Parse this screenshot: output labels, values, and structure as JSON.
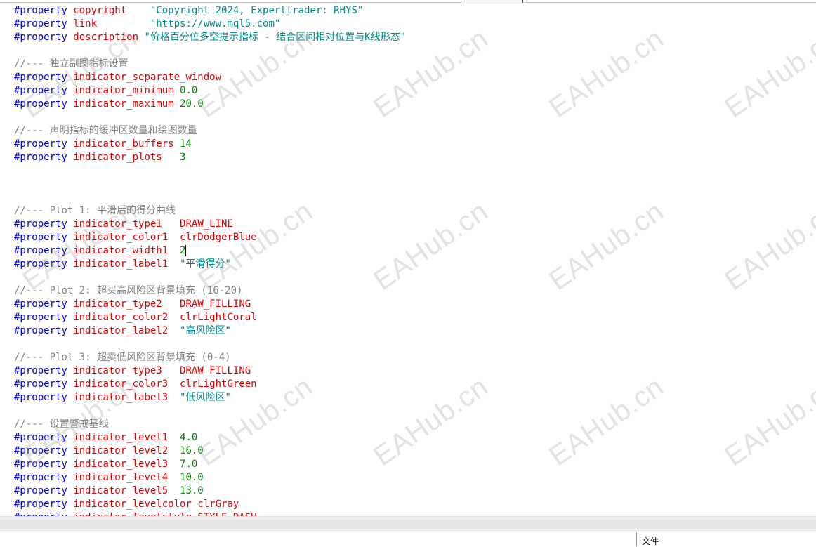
{
  "watermark": "EAHub.cn",
  "bottom_tab": "文件",
  "code_lines": [
    [
      [
        "kw",
        "#property"
      ],
      [
        "t",
        " "
      ],
      [
        "prop",
        "copyright"
      ],
      [
        "t",
        "    "
      ],
      [
        "str",
        "\"Copyright 2024, Experttrader: RHYS\""
      ]
    ],
    [
      [
        "kw",
        "#property"
      ],
      [
        "t",
        " "
      ],
      [
        "prop",
        "link"
      ],
      [
        "t",
        "         "
      ],
      [
        "str",
        "\"https://www.mql5.com\""
      ]
    ],
    [
      [
        "kw",
        "#property"
      ],
      [
        "t",
        " "
      ],
      [
        "prop",
        "description"
      ],
      [
        "t",
        " "
      ],
      [
        "str",
        "\"价格百分位多空提示指标 - 结合区间相对位置与K线形态\""
      ]
    ],
    [],
    [
      [
        "cm",
        "//--- 独立副图指标设置"
      ]
    ],
    [
      [
        "kw",
        "#property"
      ],
      [
        "t",
        " "
      ],
      [
        "prop",
        "indicator_separate_window"
      ]
    ],
    [
      [
        "kw",
        "#property"
      ],
      [
        "t",
        " "
      ],
      [
        "prop",
        "indicator_minimum"
      ],
      [
        "t",
        " "
      ],
      [
        "num",
        "0.0"
      ]
    ],
    [
      [
        "kw",
        "#property"
      ],
      [
        "t",
        " "
      ],
      [
        "prop",
        "indicator_maximum"
      ],
      [
        "t",
        " "
      ],
      [
        "num",
        "20.0"
      ]
    ],
    [],
    [
      [
        "cm",
        "//--- 声明指标的缓冲区数量和绘图数量"
      ]
    ],
    [
      [
        "kw",
        "#property"
      ],
      [
        "t",
        " "
      ],
      [
        "prop",
        "indicator_buffers"
      ],
      [
        "t",
        " "
      ],
      [
        "num",
        "14"
      ]
    ],
    [
      [
        "kw",
        "#property"
      ],
      [
        "t",
        " "
      ],
      [
        "prop",
        "indicator_plots"
      ],
      [
        "t",
        "   "
      ],
      [
        "num",
        "3"
      ]
    ],
    [],
    [],
    [],
    [
      [
        "cm",
        "//--- Plot 1: 平滑后的得分曲线"
      ]
    ],
    [
      [
        "kw",
        "#property"
      ],
      [
        "t",
        " "
      ],
      [
        "prop",
        "indicator_type1"
      ],
      [
        "t",
        "   "
      ],
      [
        "prop",
        "DRAW_LINE"
      ]
    ],
    [
      [
        "kw",
        "#property"
      ],
      [
        "t",
        " "
      ],
      [
        "prop",
        "indicator_color1"
      ],
      [
        "t",
        "  "
      ],
      [
        "prop",
        "clrDodgerBlue"
      ]
    ],
    [
      [
        "kw",
        "#property"
      ],
      [
        "t",
        " "
      ],
      [
        "prop",
        "indicator_width1"
      ],
      [
        "t",
        "  "
      ],
      [
        "num",
        "2"
      ],
      [
        "caret",
        ""
      ]
    ],
    [
      [
        "kw",
        "#property"
      ],
      [
        "t",
        " "
      ],
      [
        "prop",
        "indicator_label1"
      ],
      [
        "t",
        "  "
      ],
      [
        "str",
        "\"平滑得分\""
      ]
    ],
    [],
    [
      [
        "cm",
        "//--- Plot 2: 超买高风险区背景填充 (16-20)"
      ]
    ],
    [
      [
        "kw",
        "#property"
      ],
      [
        "t",
        " "
      ],
      [
        "prop",
        "indicator_type2"
      ],
      [
        "t",
        "   "
      ],
      [
        "prop",
        "DRAW_FILLING"
      ]
    ],
    [
      [
        "kw",
        "#property"
      ],
      [
        "t",
        " "
      ],
      [
        "prop",
        "indicator_color2"
      ],
      [
        "t",
        "  "
      ],
      [
        "prop",
        "clrLightCoral"
      ]
    ],
    [
      [
        "kw",
        "#property"
      ],
      [
        "t",
        " "
      ],
      [
        "prop",
        "indicator_label2"
      ],
      [
        "t",
        "  "
      ],
      [
        "str",
        "\"高风险区\""
      ]
    ],
    [],
    [
      [
        "cm",
        "//--- Plot 3: 超卖低风险区背景填充 (0-4)"
      ]
    ],
    [
      [
        "kw",
        "#property"
      ],
      [
        "t",
        " "
      ],
      [
        "prop",
        "indicator_type3"
      ],
      [
        "t",
        "   "
      ],
      [
        "prop",
        "DRAW_FILLING"
      ]
    ],
    [
      [
        "kw",
        "#property"
      ],
      [
        "t",
        " "
      ],
      [
        "prop",
        "indicator_color3"
      ],
      [
        "t",
        "  "
      ],
      [
        "prop",
        "clrLightGreen"
      ]
    ],
    [
      [
        "kw",
        "#property"
      ],
      [
        "t",
        " "
      ],
      [
        "prop",
        "indicator_label3"
      ],
      [
        "t",
        "  "
      ],
      [
        "str",
        "\"低风险区\""
      ]
    ],
    [],
    [
      [
        "cm",
        "//--- 设置警戒基线"
      ]
    ],
    [
      [
        "kw",
        "#property"
      ],
      [
        "t",
        " "
      ],
      [
        "prop",
        "indicator_level1"
      ],
      [
        "t",
        "  "
      ],
      [
        "num",
        "4.0"
      ]
    ],
    [
      [
        "kw",
        "#property"
      ],
      [
        "t",
        " "
      ],
      [
        "prop",
        "indicator_level2"
      ],
      [
        "t",
        "  "
      ],
      [
        "num",
        "16.0"
      ]
    ],
    [
      [
        "kw",
        "#property"
      ],
      [
        "t",
        " "
      ],
      [
        "prop",
        "indicator_level3"
      ],
      [
        "t",
        "  "
      ],
      [
        "num",
        "7.0"
      ]
    ],
    [
      [
        "kw",
        "#property"
      ],
      [
        "t",
        " "
      ],
      [
        "prop",
        "indicator_level4"
      ],
      [
        "t",
        "  "
      ],
      [
        "num",
        "10.0"
      ]
    ],
    [
      [
        "kw",
        "#property"
      ],
      [
        "t",
        " "
      ],
      [
        "prop",
        "indicator_level5"
      ],
      [
        "t",
        "  "
      ],
      [
        "num",
        "13.0"
      ]
    ],
    [
      [
        "kw",
        "#property"
      ],
      [
        "t",
        " "
      ],
      [
        "prop",
        "indicator_levelcolor"
      ],
      [
        "t",
        " "
      ],
      [
        "prop",
        "clrGray"
      ]
    ],
    [
      [
        "kw",
        "#property"
      ],
      [
        "t",
        " "
      ],
      [
        "prop",
        "indicator_levelstyle"
      ],
      [
        "t",
        " "
      ],
      [
        "prop",
        "STYLE_DASH"
      ]
    ]
  ]
}
